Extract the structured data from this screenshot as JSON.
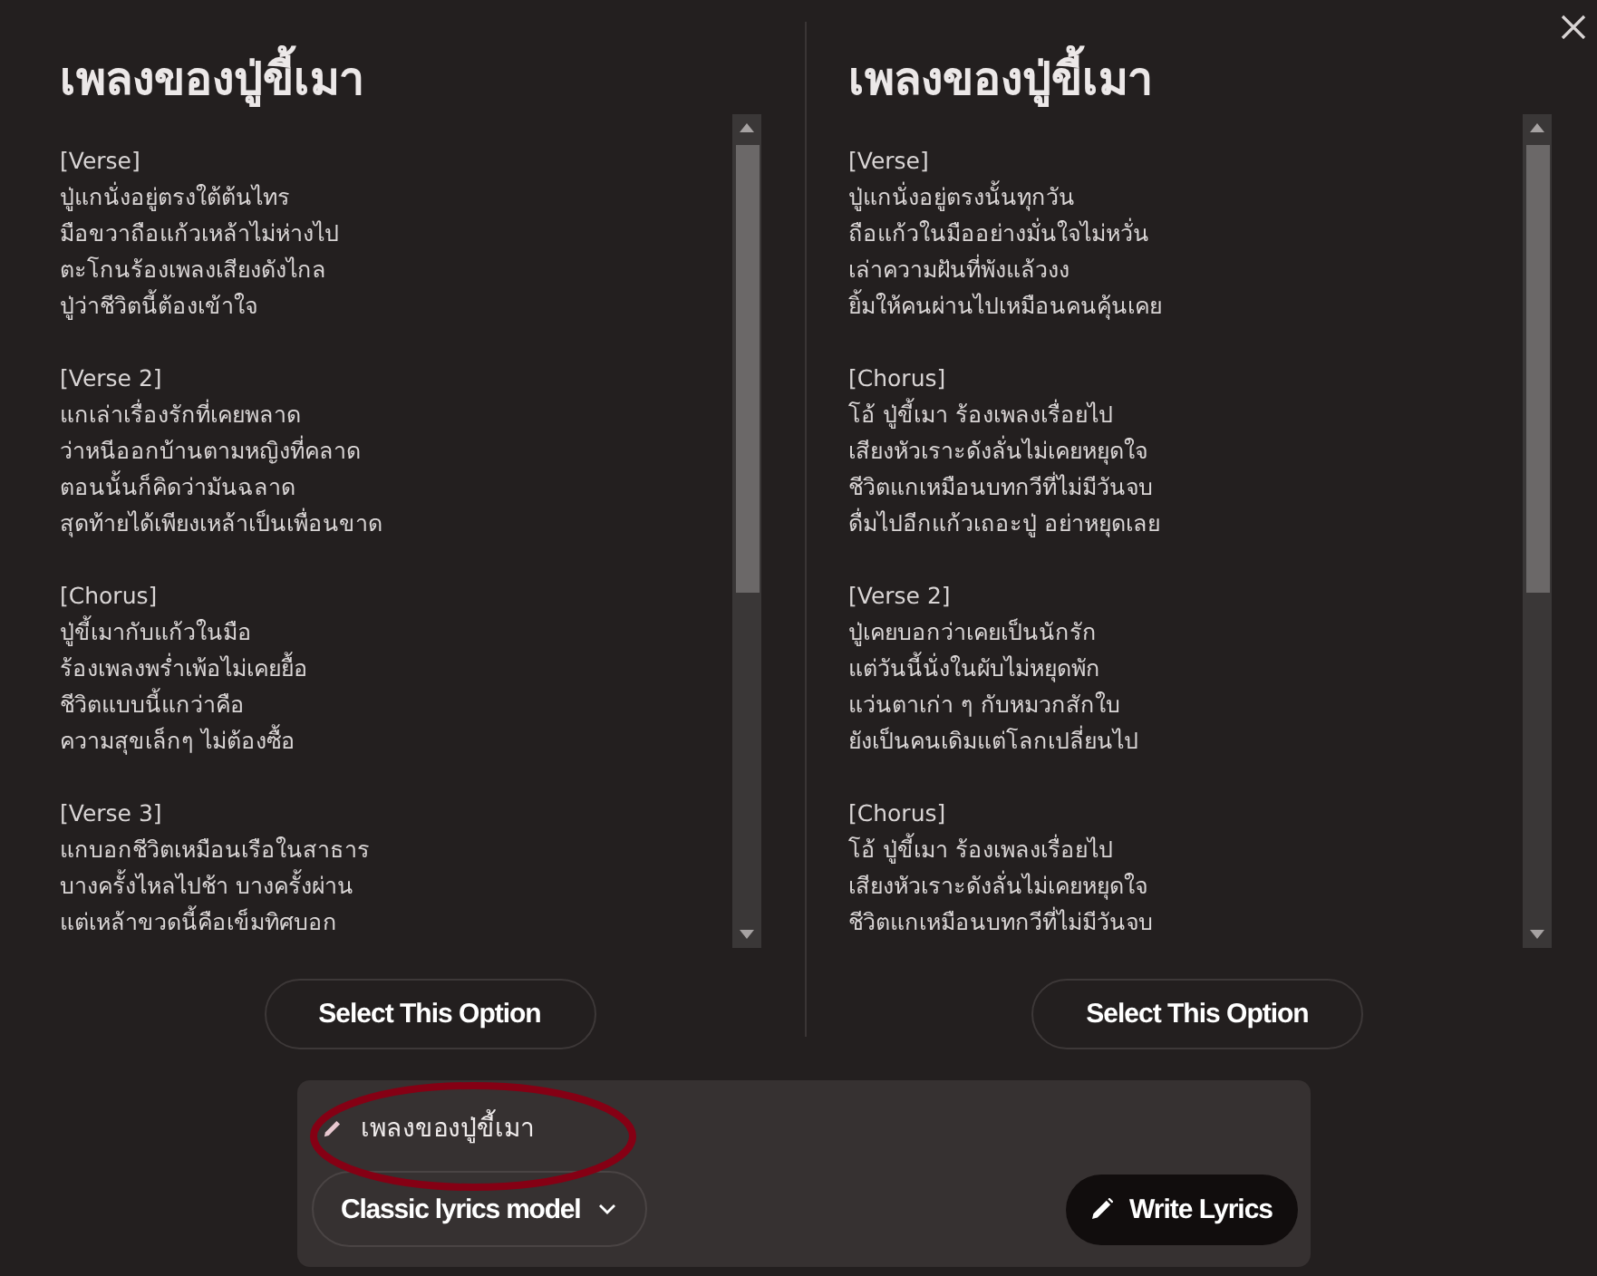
{
  "options": [
    {
      "title": "เพลงของปู่ขี้เมา",
      "sections": [
        {
          "heading": "[Verse]",
          "lines": [
            "ปู่แกนั่งอยู่ตรงใต้ต้นไทร",
            "มือขวาถือแก้วเหล้าไม่ห่างไป",
            "ตะโกนร้องเพลงเสียงดังไกล",
            "ปู่ว่าชีวิตนี้ต้องเข้าใจ"
          ]
        },
        {
          "heading": "[Verse 2]",
          "lines": [
            "แกเล่าเรื่องรักที่เคยพลาด",
            "ว่าหนีออกบ้านตามหญิงที่คลาด",
            "ตอนนั้นก็คิดว่ามันฉลาด",
            "สุดท้ายได้เพียงเหล้าเป็นเพื่อนขาด"
          ]
        },
        {
          "heading": "[Chorus]",
          "lines": [
            "ปู่ขี้เมากับแก้วในมือ",
            "ร้องเพลงพร่ำเพ้อไม่เคยยื้อ",
            "ชีวิตแบบนี้แกว่าคือ",
            "ความสุขเล็กๆ ไม่ต้องซื้อ"
          ]
        },
        {
          "heading": "[Verse 3]",
          "lines": [
            "แกบอกชีวิตเหมือนเรือในสาธาร",
            "บางครั้งไหลไปช้า บางครั้งผ่าน",
            "แต่เหล้าขวดนี้คือเข็มทิศบอก"
          ]
        }
      ],
      "button": "Select This Option"
    },
    {
      "title": "เพลงของปู่ขี้เมา",
      "sections": [
        {
          "heading": "[Verse]",
          "lines": [
            "ปู่แกนั่งอยู่ตรงนั้นทุกวัน",
            "ถือแก้วในมืออย่างมั่นใจไม่หวั่น",
            "เล่าความฝันที่พังแล้วงง",
            "ยิ้มให้คนผ่านไปเหมือนคนคุ้นเคย"
          ]
        },
        {
          "heading": "[Chorus]",
          "lines": [
            "โอ้ ปู่ขี้เมา ร้องเพลงเรื่อยไป",
            "เสียงหัวเราะดังลั่นไม่เคยหยุดใจ",
            "ชีวิตแกเหมือนบทกวีที่ไม่มีวันจบ",
            "ดื่มไปอีกแก้วเถอะปู่ อย่าหยุดเลย"
          ]
        },
        {
          "heading": "[Verse 2]",
          "lines": [
            "ปู่เคยบอกว่าเคยเป็นนักรัก",
            "แต่วันนี้นั่งในผับไม่หยุดพัก",
            "แว่นตาเก่า ๆ กับหมวกสักใบ",
            "ยังเป็นคนเดิมแต่โลกเปลี่ยนไป"
          ]
        },
        {
          "heading": "[Chorus]",
          "lines": [
            "โอ้ ปู่ขี้เมา ร้องเพลงเรื่อยไป",
            "เสียงหัวเราะดังลั่นไม่เคยหยุดใจ",
            "ชีวิตแกเหมือนบทกวีที่ไม่มีวันจบ"
          ]
        }
      ],
      "button": "Select This Option"
    }
  ],
  "prompt": {
    "value": "เพลงของปู่ขี้เมา"
  },
  "model_select": {
    "value": "Classic lyrics model"
  },
  "write_button": {
    "label": "Write Lyrics"
  },
  "annotation": {
    "kind": "ellipse"
  }
}
